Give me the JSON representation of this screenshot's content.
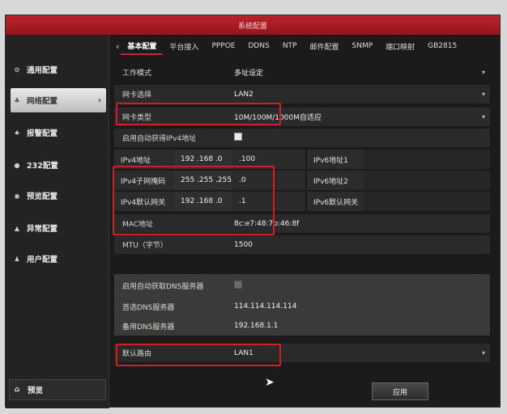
{
  "window": {
    "title": "系统配置"
  },
  "sidebar": {
    "items": [
      {
        "label": "通用配置",
        "icon": "gear-icon"
      },
      {
        "label": "网络配置",
        "icon": "network-icon",
        "active": true
      },
      {
        "label": "报警配置",
        "icon": "bell-icon"
      },
      {
        "label": "232配置",
        "icon": "serial-icon"
      },
      {
        "label": "预览配置",
        "icon": "eye-icon"
      },
      {
        "label": "异常配置",
        "icon": "warning-icon"
      },
      {
        "label": "用户配置",
        "icon": "user-icon"
      }
    ],
    "preview_label": "预览"
  },
  "tabs": [
    "基本配置",
    "平台接入",
    "PPPOE",
    "DDNS",
    "NTP",
    "邮件配置",
    "SNMP",
    "端口映射",
    "GB2815"
  ],
  "form": {
    "work_mode": {
      "label": "工作模式",
      "value": "多址设定"
    },
    "nic_select": {
      "label": "网卡选择",
      "value": "LAN2"
    },
    "nic_type": {
      "label": "网卡类型",
      "value": "10M/100M/1000M自适应"
    },
    "auto_ipv4": {
      "label": "启用自动获得IPv4地址"
    },
    "ipv4_addr": {
      "label": "IPv4地址",
      "v1": "192 .168 .0",
      "v2": ".100",
      "ipv6_label": "IPv6地址1"
    },
    "ipv4_mask": {
      "label": "IPv4子网掩码",
      "v1": "255 .255 .255",
      "v2": ".0",
      "ipv6_label": "IPv6地址2"
    },
    "ipv4_gw": {
      "label": "IPv4默认网关",
      "v1": "192 .168 .0",
      "v2": ".1",
      "ipv6_label": "IPv6默认网关"
    },
    "mac": {
      "label": "MAC地址",
      "value": "8c:e7:48:7b:46:8f"
    },
    "mtu": {
      "label": "MTU（字节）",
      "value": "1500"
    },
    "auto_dns": {
      "label": "启用自动获取DNS服务器"
    },
    "dns1": {
      "label": "首选DNS服务器",
      "value": "114.114.114.114"
    },
    "dns2": {
      "label": "备用DNS服务器",
      "value": "192.168.1.1"
    },
    "default_route": {
      "label": "默认路由",
      "value": "LAN1"
    }
  },
  "apply_label": "应用",
  "colors": {
    "accent": "#c0262d",
    "highlight": "#d21d28",
    "background": "#1b1b1b"
  }
}
